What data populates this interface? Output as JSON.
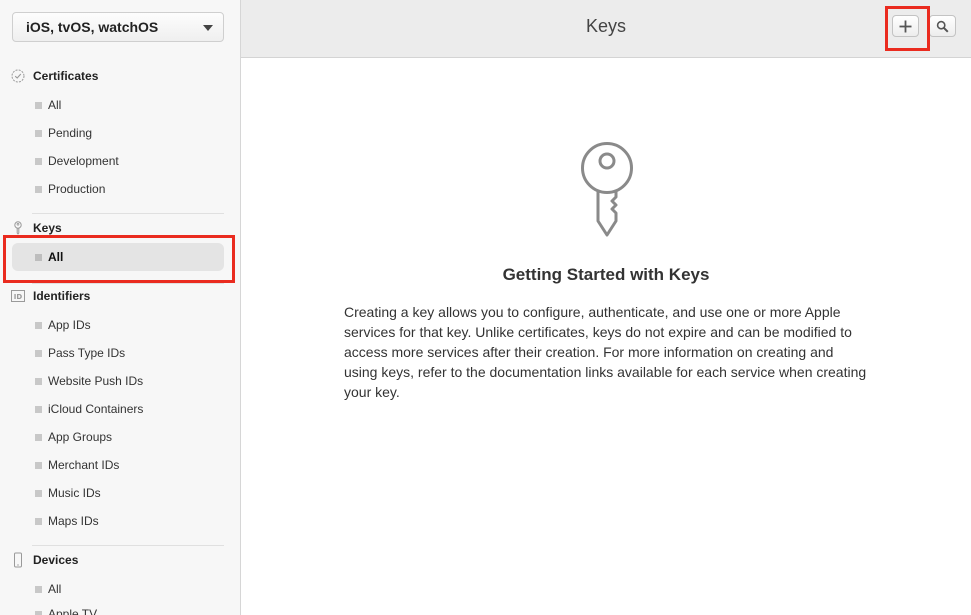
{
  "platform_select": {
    "value": "iOS, tvOS, watchOS"
  },
  "sidebar": {
    "certificates": {
      "title": "Certificates",
      "icon": "certificate-icon",
      "items": [
        "All",
        "Pending",
        "Development",
        "Production"
      ]
    },
    "keys": {
      "title": "Keys",
      "icon": "key-icon",
      "items": [
        "All"
      ],
      "active": "All"
    },
    "identifiers": {
      "title": "Identifiers",
      "icon": "id-icon",
      "icon_text": "ID",
      "items": [
        "App IDs",
        "Pass Type IDs",
        "Website Push IDs",
        "iCloud Containers",
        "App Groups",
        "Merchant IDs",
        "Music IDs",
        "Maps IDs"
      ]
    },
    "devices": {
      "title": "Devices",
      "icon": "device-icon",
      "items": [
        "All",
        "Apple TV"
      ]
    }
  },
  "header": {
    "title": "Keys",
    "add_button_icon": "plus-icon",
    "search_button_icon": "search-icon"
  },
  "main": {
    "icon": "key-icon",
    "heading": "Getting Started with Keys",
    "description": "Creating a key allows you to configure, authenticate, and use one or more Apple services for that key. Unlike certificates, keys do not expire and can be modified to access more services after their creation. For more information on creating and using keys, refer to the documentation links available for each service when creating your key."
  },
  "colors": {
    "highlight": "#ea2b1f",
    "sidebar_bg": "#f7f7f7",
    "header_bg": "#ececec"
  }
}
